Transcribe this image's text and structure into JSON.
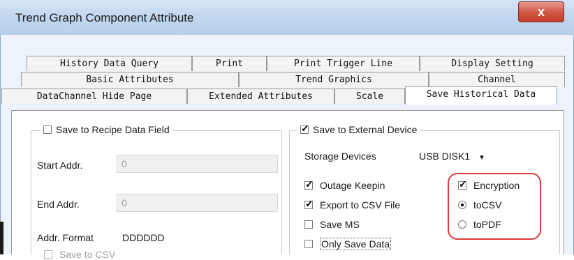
{
  "window": {
    "title": "Trend Graph Component Attribute",
    "close_glyph": "x"
  },
  "tabs": {
    "row1": [
      "History Data Query",
      "Print",
      "Print Trigger Line",
      "Display Setting"
    ],
    "row2": [
      "Basic Attributes",
      "Trend Graphics",
      "Channel"
    ],
    "row3": [
      "DataChannel Hide Page",
      "Extended Attributes",
      "Scale",
      "Save Historical Data"
    ],
    "active": "Save Historical Data"
  },
  "recipe_group": {
    "legend": "Save to Recipe Data Field",
    "checked": false,
    "start_addr_label": "Start Addr.",
    "start_addr_value": "0",
    "end_addr_label": "End Addr.",
    "end_addr_value": "0",
    "addr_format_label": "Addr. Format",
    "addr_format_value": "DDDDDD",
    "partial_option": "Save to CSV"
  },
  "external_group": {
    "legend": "Save to External Device",
    "checked": true,
    "storage_label": "Storage Devices",
    "storage_value": "USB DISK1",
    "options": {
      "outage_keepin": {
        "label": "Outage Keepin",
        "checked": true
      },
      "export_csv": {
        "label": "Export to CSV File",
        "checked": true
      },
      "save_ms": {
        "label": "Save MS",
        "checked": false
      },
      "only_save_data": {
        "label": "Only Save Data",
        "checked": false
      },
      "encryption": {
        "label": "Encryption",
        "checked": true
      }
    },
    "format_radio": {
      "to_csv": {
        "label": "toCSV",
        "selected": true
      },
      "to_pdf": {
        "label": "toPDF",
        "selected": false
      }
    }
  },
  "colors": {
    "highlight": "#e23a3a",
    "close_button": "#c23d27",
    "titlebar": "#c2d8ef"
  }
}
